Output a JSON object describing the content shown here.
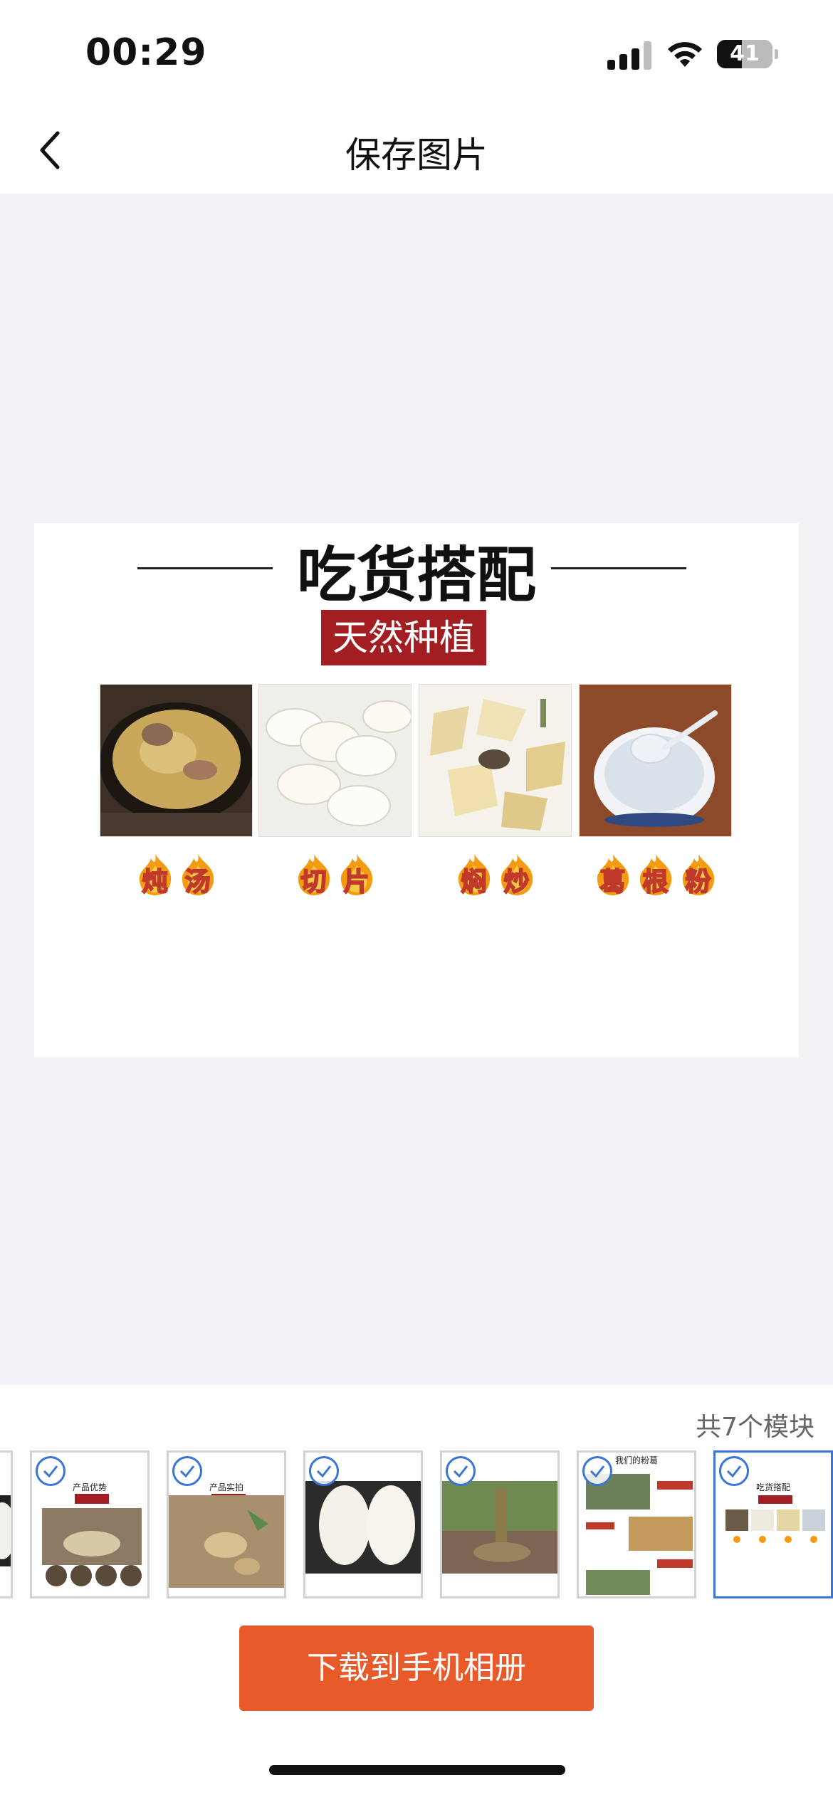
{
  "status_bar": {
    "time": "00:29",
    "battery_level": "41"
  },
  "nav": {
    "title": "保存图片"
  },
  "preview": {
    "heading": "吃货搭配",
    "badge": "天然种植",
    "items": [
      {
        "label": [
          "炖",
          "汤"
        ],
        "photo": "stew-photo"
      },
      {
        "label": [
          "切",
          "片"
        ],
        "photo": "sliced-photo"
      },
      {
        "label": [
          "焖",
          "炒"
        ],
        "photo": "stirfry-photo"
      },
      {
        "label": [
          "葛",
          "根",
          "粉"
        ],
        "photo": "powder-photo"
      }
    ]
  },
  "modules": {
    "count_text": "共7个模块",
    "thumbnails": [
      {
        "title": "",
        "selected": false
      },
      {
        "title": "产品优势",
        "selected": false
      },
      {
        "title": "产品实拍",
        "selected": false
      },
      {
        "title": "",
        "selected": false
      },
      {
        "title": "",
        "selected": false
      },
      {
        "title": "我们的粉葛",
        "selected": false
      },
      {
        "title": "吃货搭配",
        "selected": true
      }
    ]
  },
  "actions": {
    "download_label": "下载到手机相册"
  },
  "colors": {
    "accent": "#e85a2a",
    "select_blue": "#3a74d8",
    "badge_red": "#a31e22"
  }
}
